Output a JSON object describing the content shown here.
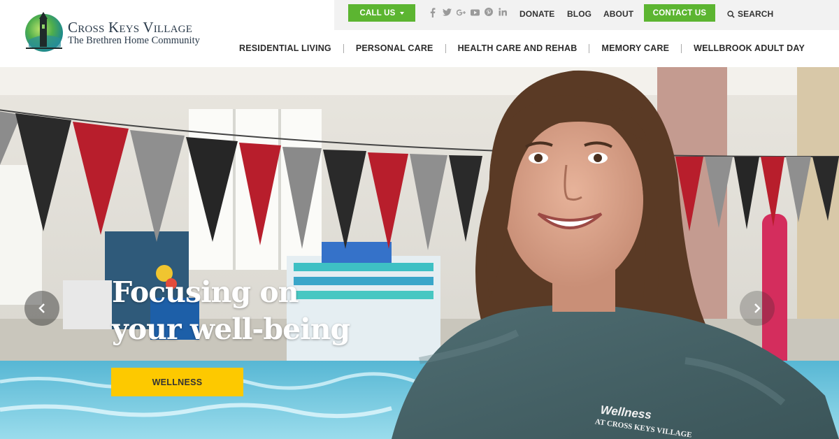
{
  "brand": {
    "name": "Cross Keys Village",
    "tagline": "The Brethren Home Community"
  },
  "topbar": {
    "call_label": "CALL US",
    "social_icons": [
      "facebook-icon",
      "twitter-icon",
      "google-plus-icon",
      "youtube-icon",
      "pinterest-icon",
      "linkedin-icon"
    ],
    "donate": "DONATE",
    "blog": "BLOG",
    "about": "ABOUT",
    "contact_label": "CONTACT US",
    "search_label": "SEARCH"
  },
  "nav": {
    "items": [
      {
        "label": "RESIDENTIAL LIVING"
      },
      {
        "label": "PERSONAL CARE"
      },
      {
        "label": "HEALTH CARE AND REHAB"
      },
      {
        "label": "MEMORY CARE"
      },
      {
        "label": "WELLBROOK ADULT DAY"
      }
    ]
  },
  "hero": {
    "headline_line1": "Focusing on",
    "headline_line2": "your well-being",
    "cta_label": "WELLNESS",
    "shirt_text_1": "Wellness",
    "shirt_text_2": "AT CROSS KEYS VILLAGE"
  },
  "colors": {
    "green": "#5cb531",
    "yellow": "#fdc900",
    "topbar_bg": "#f2f2f2"
  }
}
